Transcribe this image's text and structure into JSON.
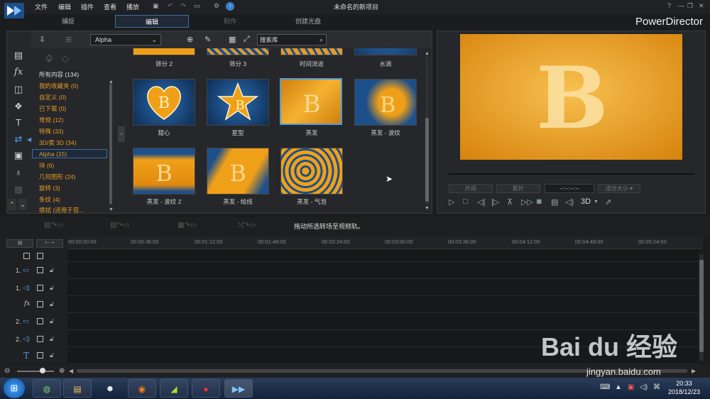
{
  "menu": [
    "文件",
    "编辑",
    "插件",
    "查看",
    "播放"
  ],
  "window_title": "未命名的新项目",
  "tabs": [
    "捕捉",
    "编辑",
    "制作",
    "创建光盘"
  ],
  "brand": "PowerDirector",
  "library": {
    "dropdown": "Alpha",
    "search_placeholder": "搜索库",
    "categories": [
      "所有内容 (134)",
      "我的收藏夹 (0)",
      "自定义 (0)",
      "已下载 (0)",
      "常规 (12)",
      "特殊 (33)",
      "3D/类 3D (34)",
      "Alpha (15)",
      "块 (6)",
      "几何图形 (24)",
      "旋转 (3)",
      "条纹 (4)",
      "擦拭 (适用于音..."
    ],
    "top_labels": [
      "筛分 2",
      "筛分 3",
      "时间流逝",
      "水滴"
    ],
    "row1": [
      "甜心",
      "星型",
      "蒸发",
      "蒸发 - 波纹"
    ],
    "row2": [
      "蒸发 - 波纹 2",
      "蒸发 - 绘线",
      "蒸发 - 气泡"
    ]
  },
  "preview": {
    "clip_btn": "片段",
    "movie_btn": "影片",
    "timecode": "--:--:--:--",
    "size_label": "适合大小",
    "mode": "3D"
  },
  "timeline": {
    "hint": "拖动所选转场至视频轨。",
    "ticks": [
      "00:00:00:00",
      "00:00:36:00",
      "00:01:12:00",
      "00:01:48:00",
      "00:02:24:00",
      "00:03:00:00",
      "00:03:36:00",
      "00:04:12:00",
      "00:04:48:00",
      "00:05:24:00"
    ],
    "tracks": [
      "1.",
      "1.",
      "fx",
      "2.",
      "2.",
      "T"
    ]
  },
  "taskbar": {
    "time": "20:33",
    "date": "2018/12/23"
  },
  "watermark": {
    "brand": "Bai du 经验",
    "url": "jingyan.baidu.com"
  },
  "colors": {
    "accent": "#e39a28",
    "selection": "#4e9be0",
    "orange": "#f0a018"
  }
}
